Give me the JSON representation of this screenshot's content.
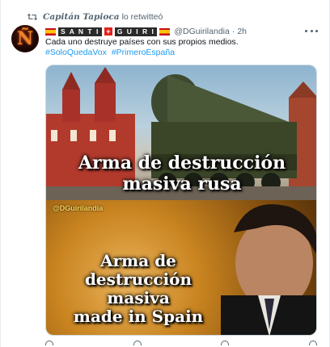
{
  "retweet": {
    "retweeter_name": "Capitán Tapioca",
    "suffix": "lo retwitteó"
  },
  "author": {
    "avatar_letter": "Ñ",
    "badge_words": [
      "S A N T I",
      "G U I R I"
    ],
    "handle": "@DGuirilandia",
    "separator": "·",
    "time": "2h"
  },
  "tweet": {
    "text": "Cada uno destruye países con sus propios medios.",
    "hashtags": [
      "#SoloQuedaVox",
      "#PrimeroEspaña"
    ]
  },
  "media": {
    "top_caption_line1": "Arma de destrucción",
    "top_caption_line2": "masiva rusa",
    "watermark": "@DGuirilandia",
    "bottom_caption_lines": [
      "Arma de",
      "destrucción",
      "masiva",
      "made in Spain"
    ]
  },
  "colors": {
    "link": "#1d9bf0",
    "muted_text": "#536471",
    "main_text": "#0f1419"
  },
  "icons": [
    "retweet-icon",
    "more-options-icon",
    "spain-flag-icon",
    "swiss-flag-icon"
  ]
}
